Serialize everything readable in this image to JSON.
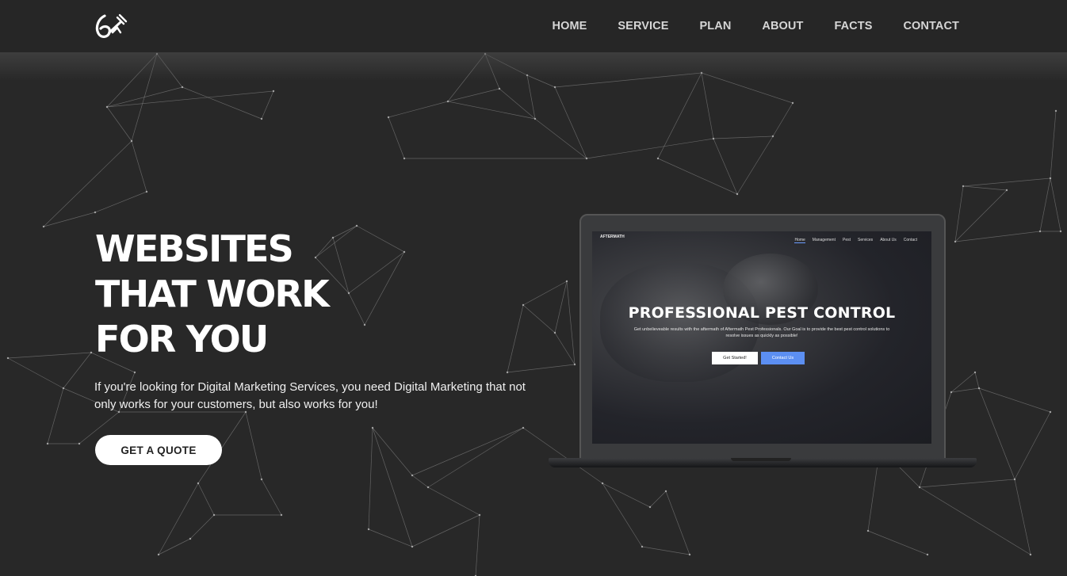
{
  "nav": {
    "logo_icon": "stylized-6-satellite-logo",
    "links": [
      "HOME",
      "SERVICE",
      "PLAN",
      "ABOUT",
      "FACTS",
      "CONTACT"
    ]
  },
  "hero": {
    "title_lines": [
      "WEBSITES",
      "THAT WORK",
      "FOR YOU"
    ],
    "description": "If you're looking for Digital Marketing Services, you need Digital Marketing that not only works for your customers, but also works for you!",
    "cta_label": "GET A QUOTE"
  },
  "laptop_screen": {
    "logo_text": "AFTERMATH",
    "nav_links": [
      "Home",
      "Management",
      "Pest",
      "Services",
      "About Us",
      "Contact"
    ],
    "title": "PROFESSIONAL PEST CONTROL",
    "subtitle": "Get unbelieveable results with the aftermath of Aftermath Pest Professionals. Our Goal is to provide the best pest control solutions to resolve issues as quickly as possible!",
    "primary_button": "Get Started!",
    "secondary_button": "Contact Us"
  },
  "colors": {
    "background": "#282828",
    "navbar": "#262626",
    "nav_text": "#d6d6d6",
    "accent_blue": "#5c8ff2",
    "network_lines": "#8a8a8a"
  }
}
